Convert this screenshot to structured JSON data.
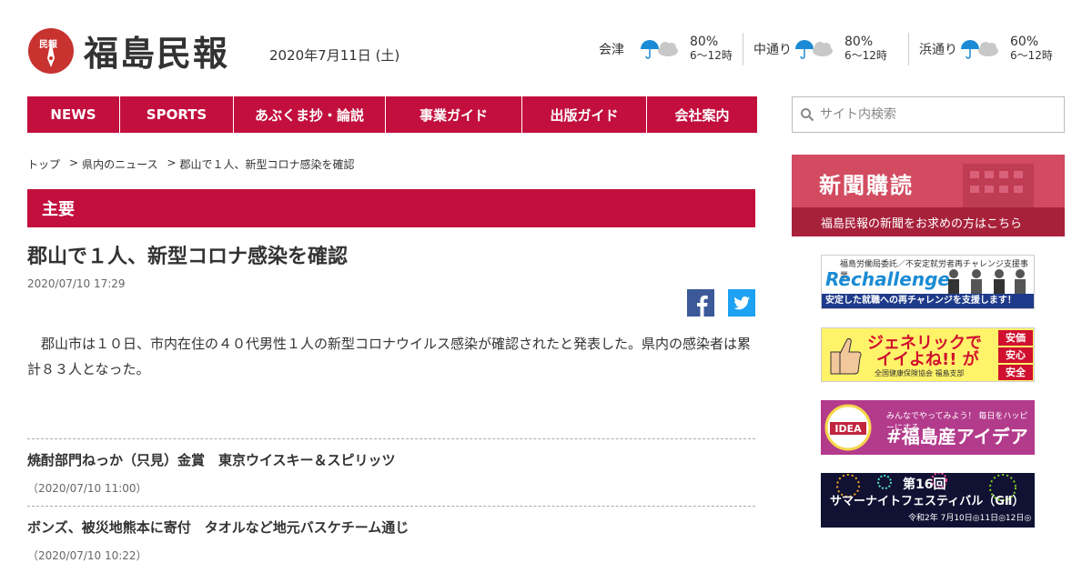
{
  "header": {
    "logo_text": "福島民報",
    "seal_text": "民報",
    "date": "2020年7月11日 (土)"
  },
  "weather": [
    {
      "region": "会津",
      "pct": "80%",
      "time": "6～12時"
    },
    {
      "region": "中通り",
      "pct": "80%",
      "time": "6～12時"
    },
    {
      "region": "浜通り",
      "pct": "60%",
      "time": "6～12時"
    }
  ],
  "nav": [
    {
      "label": "NEWS"
    },
    {
      "label": "SPORTS"
    },
    {
      "label": "あぶくま抄・論説"
    },
    {
      "label": "事業ガイド"
    },
    {
      "label": "出版ガイド"
    },
    {
      "label": "会社案内"
    }
  ],
  "search": {
    "placeholder": "サイト内検索"
  },
  "breadcrumb": [
    "トップ",
    "県内のニュース",
    "郡山で１人、新型コロナ感染を確認"
  ],
  "section": "主要",
  "article": {
    "title": "郡山で１人、新型コロナ感染を確認",
    "date": "2020/07/10 17:29",
    "body": "郡山市は１０日、市内在住の４０代男性１人の新型コロナウイルス感染が確認されたと発表した。県内の感染者は累計８３人となった。"
  },
  "related": [
    {
      "title": "焼酎部門ねっか（只見）金賞　東京ウイスキー＆スピリッツ",
      "date": "（2020/07/10 11:00）"
    },
    {
      "title": "ボンズ、被災地熊本に寄付　タオルなど地元バスケチーム通じ",
      "date": "（2020/07/10 10:22）"
    }
  ],
  "sidebar": {
    "subscribe_title": "新聞購読",
    "subscribe_sub": "福島民報の新聞をお求めの方はこちら",
    "banner1": {
      "l1": "福島労働局委託／不安定就労者再チャレンジ支援事業",
      "l2": "Rechallenge",
      "l3": "安定した就職への再チャレンジを支援します！"
    },
    "banner2": {
      "l1": "ジェネリックで",
      "l2": "イイよね!! が",
      "l3": "全国健康保険協会 福島支部",
      "tags": [
        "安価",
        "安心",
        "安全"
      ]
    },
    "banner3": {
      "l1": "みんなでやってみよう！ 毎日をハッピーにする",
      "l2": "#福島産アイデア",
      "logo": "IDEA"
    },
    "banner4": {
      "l1": "第16回",
      "l2": "サマーナイトフェスティバル（GⅡ）",
      "l3": "令和2年 7月10日◎11日◎12日◎"
    }
  },
  "colors": {
    "brand": "#c20f3e",
    "subscribe": "#d24b60",
    "facebook": "#3b5998",
    "twitter": "#1da1f2"
  }
}
